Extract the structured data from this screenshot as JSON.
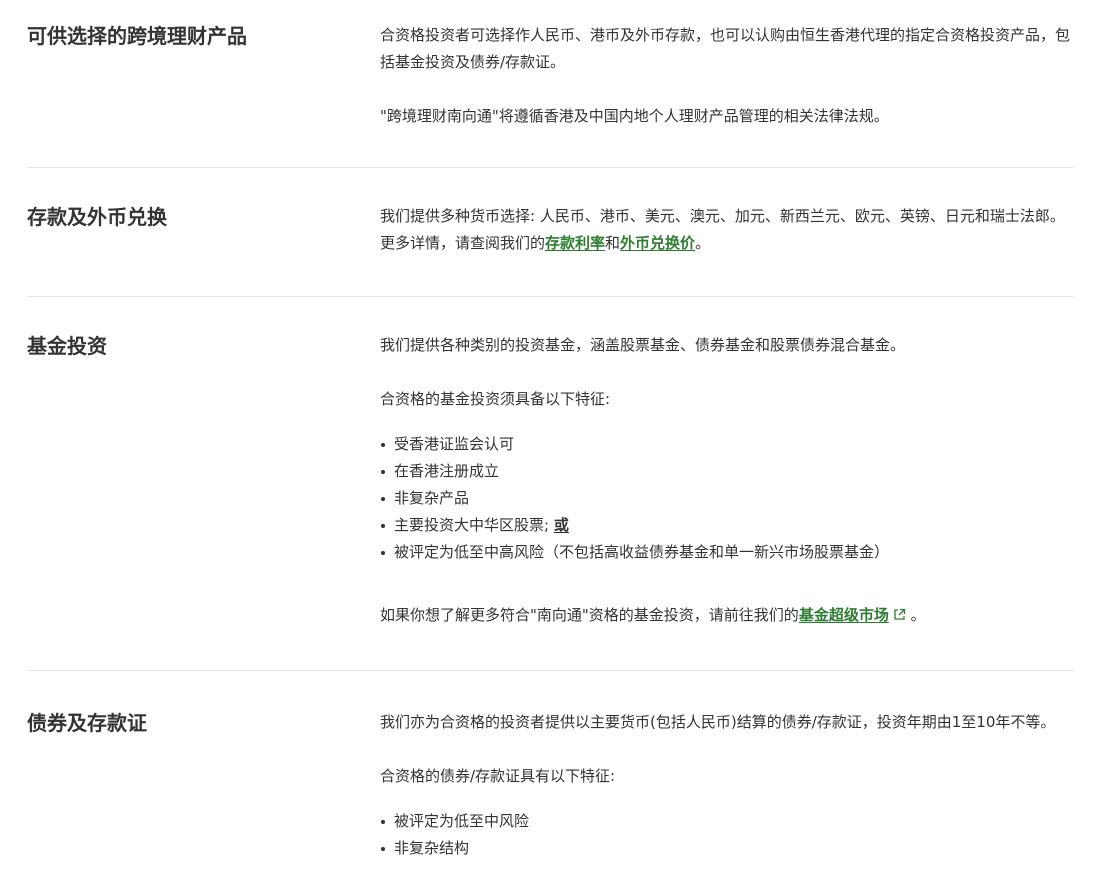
{
  "sections": [
    {
      "title": "可供选择的跨境理财产品",
      "p1": "合资格投资者可选择作人民币、港币及外币存款，也可以认购由恒生香港代理的指定合资格投资产品，包括基金投资及债券/存款证。",
      "p2": "\"跨境理财南向通\"将遵循香港及中国内地个人理财产品管理的相关法律法规。"
    },
    {
      "title": "存款及外币兑换",
      "p1_prefix": "我们提供多种货币选择: 人民币、港币、美元、澳元、加元、新西兰元、欧元、英镑、日元和瑞士法郎。更多详情，请查阅我们的",
      "link1": "存款利率",
      "mid": "和",
      "link2": "外币兑换价",
      "suffix": "。"
    },
    {
      "title": "基金投资",
      "p1": "我们提供各种类别的投资基金，涵盖股票基金、债券基金和股票债券混合基金。",
      "p2": "合资格的基金投资须具备以下特征:",
      "bullets": [
        "受香港证监会认可",
        "在香港注册成立",
        "非复杂产品",
        "主要投资大中华区股票; "
      ],
      "bullet4_emph": "或",
      "bullet5": "被评定为低至中高风险（不包括高收益债券基金和单一新兴市场股票基金）",
      "p3_prefix": "如果你想了解更多符合\"南向通\"资格的基金投资，请前往我们的",
      "link": "基金超级市场",
      "p3_suffix": " 。"
    },
    {
      "title": "债券及存款证",
      "p1": "我们亦为合资格的投资者提供以主要货币(包括人民币)结算的债券/存款证，投资年期由1至10年不等。",
      "p2": "合资格的债券/存款证具有以下特征:",
      "bullets": [
        "被评定为低至中风险",
        "非复杂结构"
      ]
    }
  ],
  "colors": {
    "link": "#2e7d32",
    "text": "#333333",
    "divider": "#e5e5e5"
  },
  "icons": {
    "external": "external-link-icon"
  }
}
